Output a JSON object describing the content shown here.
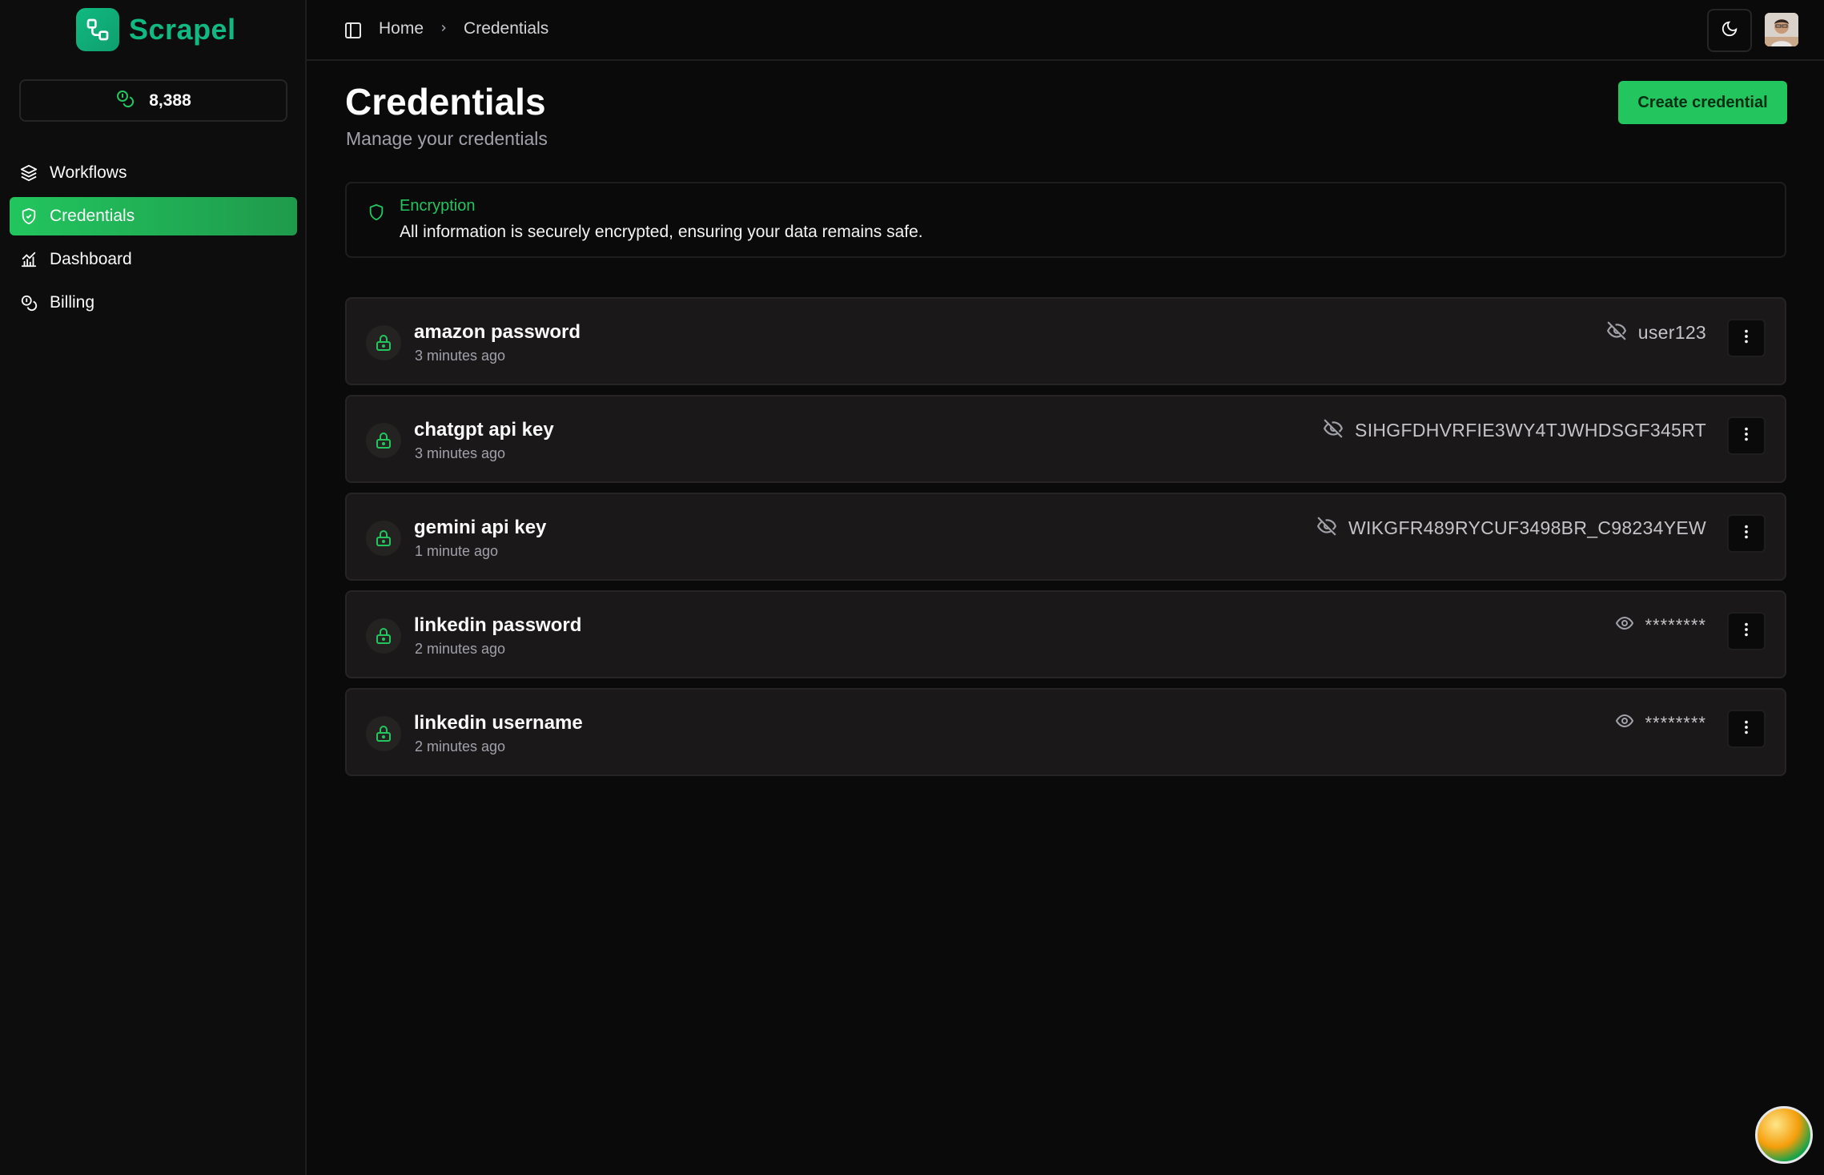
{
  "app": {
    "name": "Scrapel",
    "brand_color": "#10b981",
    "accent_color": "#22c55e"
  },
  "sidebar": {
    "credits": "8,388",
    "items": [
      {
        "label": "Workflows",
        "icon": "layers-icon",
        "active": false
      },
      {
        "label": "Credentials",
        "icon": "shield-check-icon",
        "active": true
      },
      {
        "label": "Dashboard",
        "icon": "chart-icon",
        "active": false
      },
      {
        "label": "Billing",
        "icon": "coins-icon",
        "active": false
      }
    ]
  },
  "breadcrumb": {
    "home": "Home",
    "current": "Credentials"
  },
  "header": {
    "title": "Credentials",
    "subtitle": "Manage your credentials",
    "create_label": "Create credential"
  },
  "alert": {
    "title": "Encryption",
    "description": "All information is securely encrypted, ensuring your data remains safe."
  },
  "credentials": [
    {
      "name": "amazon password",
      "time": "3 minutes ago",
      "value": "user123",
      "revealed": true
    },
    {
      "name": "chatgpt api key",
      "time": "3 minutes ago",
      "value": "SIHGFDHVRFIE3WY4TJWHDSGF345RT",
      "revealed": true
    },
    {
      "name": "gemini api key",
      "time": "1 minute ago",
      "value": "WIKGFR489RYCUF3498BR_C98234YEW",
      "revealed": true
    },
    {
      "name": "linkedin password",
      "time": "2 minutes ago",
      "value": "********",
      "revealed": false
    },
    {
      "name": "linkedin username",
      "time": "2 minutes ago",
      "value": "********",
      "revealed": false
    }
  ]
}
